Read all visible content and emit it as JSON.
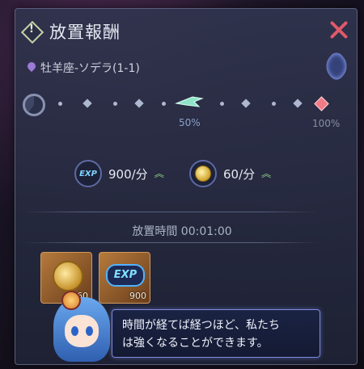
{
  "window": {
    "title": "放置報酬",
    "info_icon": "exclamation-diamond-icon",
    "close_icon": "close-icon"
  },
  "location": {
    "name": "牡羊座-ソデラ(1-1)",
    "icon": "location-pin-icon"
  },
  "progress": {
    "percent_current": 0.5,
    "label_mid": "50%",
    "label_end": "100%"
  },
  "rates": {
    "exp": {
      "value": "900/分",
      "icon": "exp-icon",
      "trend_icon": "double-chevron-up-icon"
    },
    "gold": {
      "value": "60/分",
      "icon": "gold-coin-icon",
      "trend_icon": "double-chevron-up-icon"
    }
  },
  "idle": {
    "label": "放置時間",
    "time": "00:01:00"
  },
  "rewards": [
    {
      "name": "gold",
      "icon": "gold-coin-icon",
      "qty": "60"
    },
    {
      "name": "exp",
      "icon": "exp-icon",
      "qty": "900"
    }
  ],
  "dialog": {
    "line1": "時間が経てば経つほど、私たち",
    "line2": "は強くなることができます。"
  },
  "colors": {
    "close": "#e0596a",
    "accent_end": "#f07a86",
    "progress_label": "#8aa0c8",
    "bubble_border": "#7e8ad8"
  }
}
